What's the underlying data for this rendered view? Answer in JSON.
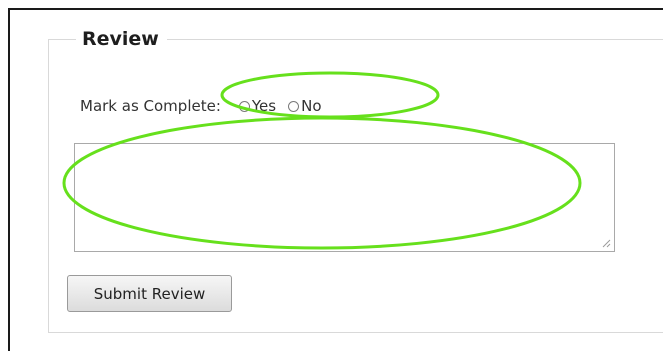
{
  "review": {
    "legend": "Review",
    "mark_complete_label": "Mark as Complete:",
    "options": [
      {
        "label": "Yes",
        "selected": false
      },
      {
        "label": "No",
        "selected": false
      }
    ],
    "textarea_value": "",
    "submit_label": "Submit Review"
  },
  "colors": {
    "annotation_outline": "#66e01c",
    "fieldset_border": "#d9d9d9"
  }
}
